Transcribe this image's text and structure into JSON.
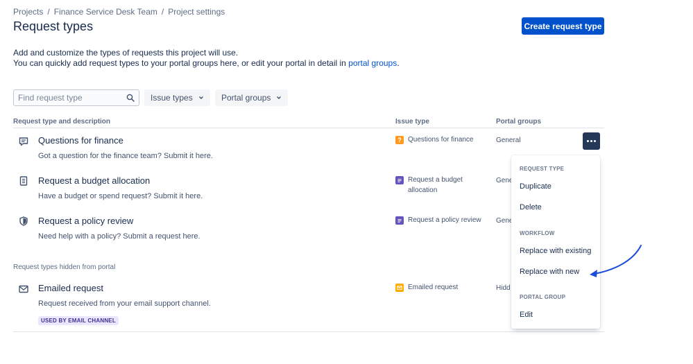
{
  "breadcrumb": [
    "Projects",
    "Finance Service Desk Team",
    "Project settings"
  ],
  "breadcrumb_separator": "/",
  "page_title": "Request types",
  "create_button": "Create request type",
  "description": {
    "line1": "Add and customize the types of requests this project will use.",
    "line2_prefix": "You can quickly add request types to your portal groups here, or edit your portal in detail in ",
    "line2_link": "portal groups",
    "line2_suffix": "."
  },
  "search": {
    "placeholder": "Find request type",
    "value": "",
    "icon": "search-icon"
  },
  "filters": {
    "issue_types": "Issue types",
    "portal_groups": "Portal groups"
  },
  "columns": {
    "request_type": "Request type and description",
    "issue_type": "Issue type",
    "portal_groups": "Portal groups"
  },
  "rows": [
    {
      "title": "Questions for finance",
      "description": "Got a question for the finance team? Submit it here.",
      "issue_type": "Questions for finance",
      "portal_group": "General",
      "icon": "chat-icon",
      "issue_icon_color": "#ff991f"
    },
    {
      "title": "Request a budget allocation",
      "description": "Have a budget or spend request? Submit it here.",
      "issue_type_line1": "Request a budget",
      "issue_type_line2": "allocation",
      "portal_group": "Gene",
      "icon": "document-icon",
      "issue_icon_color": "#6554c0"
    },
    {
      "title": "Request a policy review",
      "description": "Need help with a policy? Submit a request here.",
      "issue_type": "Request a policy review",
      "portal_group": "Gene",
      "icon": "shield-icon",
      "issue_icon_color": "#6554c0"
    }
  ],
  "hidden_section_label": "Request types hidden from portal",
  "hidden_rows": [
    {
      "title": "Emailed request",
      "description": "Request received from your email support channel.",
      "issue_type": "Emailed request",
      "portal_group": "Hidd",
      "lozenge": "USED BY EMAIL CHANNEL",
      "icon": "mail-icon",
      "issue_icon_color": "#ffab00"
    }
  ],
  "menu": {
    "request_type_head": "REQUEST TYPE",
    "duplicate": "Duplicate",
    "delete": "Delete",
    "workflow_head": "WORKFLOW",
    "replace_existing": "Replace with existing",
    "replace_new": "Replace with new",
    "portal_group_head": "PORTAL GROUP",
    "edit": "Edit"
  },
  "colors": {
    "primary": "#0052cc",
    "text": "#172b4d",
    "arrow": "#1d4ed8"
  }
}
